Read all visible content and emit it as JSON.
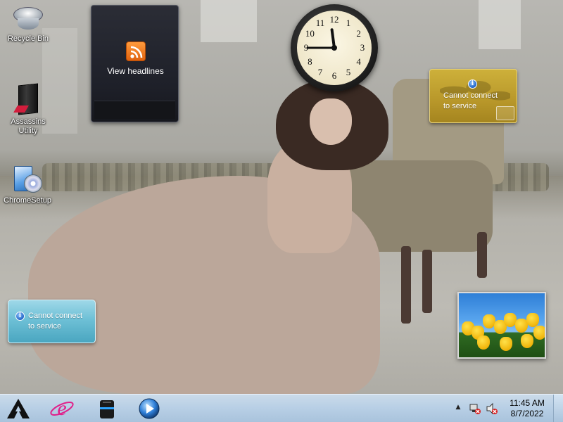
{
  "desktop": {
    "icons": [
      {
        "label": "Recycle Bin",
        "icon": "recycle-bin-icon"
      },
      {
        "label": "Assassins Utility",
        "icon": "assassins-utility-icon"
      },
      {
        "label": "ChromeSetup",
        "icon": "setup-installer-icon"
      }
    ]
  },
  "gadgets": {
    "feed_headlines": {
      "label": "View headlines",
      "icon": "rss-feed-icon"
    },
    "clock": {
      "hour": 11,
      "minute": 45,
      "numbers": [
        "12",
        "1",
        "2",
        "3",
        "4",
        "5",
        "6",
        "7",
        "8",
        "9",
        "10",
        "11"
      ]
    },
    "weather": {
      "message_line1": "Cannot connect",
      "message_line2": "to service",
      "icon": "info-icon",
      "color": "#c3a532"
    },
    "currency": {
      "message_line1": "Cannot connect",
      "message_line2": "to service",
      "icon": "info-icon",
      "color": "#6ec0d6"
    },
    "slideshow": {
      "subject": "yellow tulips"
    }
  },
  "taskbar": {
    "pinned": [
      {
        "name": "start-button",
        "icon": "start-logo-icon"
      },
      {
        "name": "internet-explorer",
        "icon": "internet-explorer-icon"
      },
      {
        "name": "file-explorer",
        "icon": "drive-icon"
      },
      {
        "name": "media-player",
        "icon": "play-icon"
      }
    ],
    "tray": {
      "show_hidden": "▲",
      "time": "11:45 AM",
      "date": "8/7/2022"
    }
  }
}
